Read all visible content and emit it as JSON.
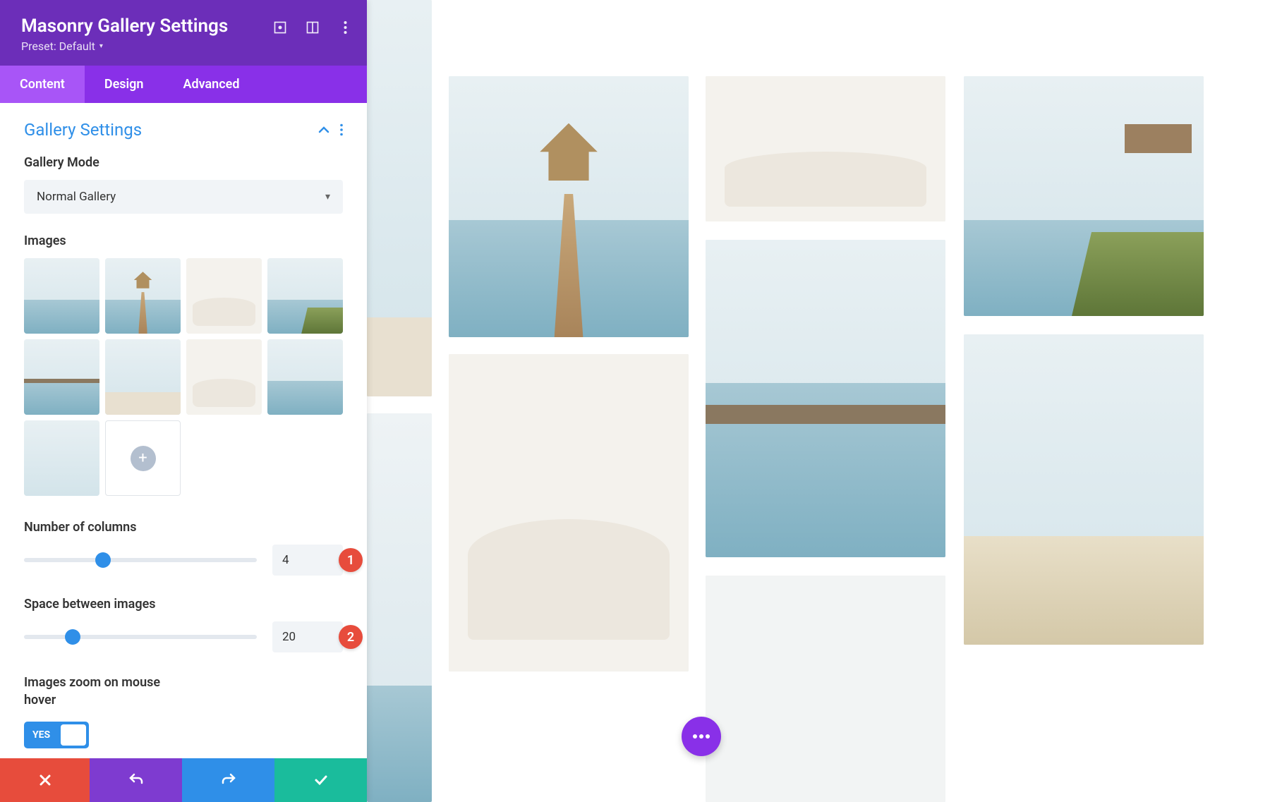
{
  "header": {
    "title": "Masonry Gallery Settings",
    "preset_label": "Preset: Default"
  },
  "tabs": {
    "content": "Content",
    "design": "Design",
    "advanced": "Advanced"
  },
  "section": {
    "title": "Gallery Settings"
  },
  "gallery_mode": {
    "label": "Gallery Mode",
    "value": "Normal Gallery"
  },
  "images": {
    "label": "Images"
  },
  "num_columns": {
    "label": "Number of columns",
    "value": "4",
    "percent": 34,
    "badge": "1"
  },
  "space": {
    "label": "Space between images",
    "value": "20",
    "percent": 21,
    "badge": "2"
  },
  "zoom": {
    "label": "Images zoom on mouse hover",
    "toggle_text": "YES"
  }
}
